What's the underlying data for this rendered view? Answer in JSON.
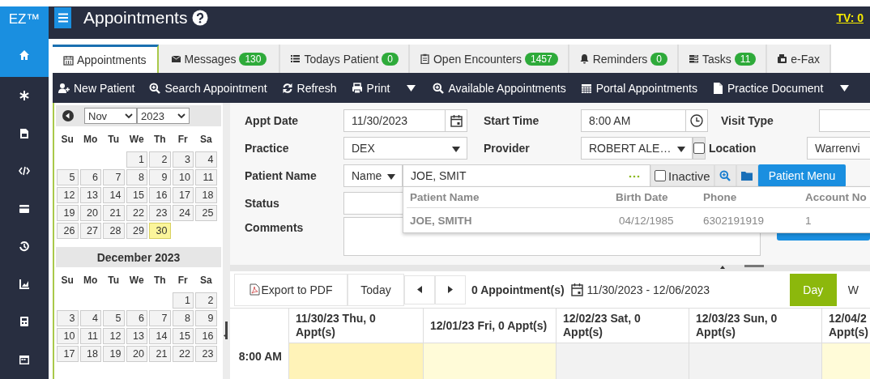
{
  "sidebar": {
    "brand": "EZ™",
    "items": [
      {
        "selected": true
      },
      {
        "selected": false
      },
      {
        "selected": false
      },
      {
        "selected": false
      },
      {
        "selected": false
      },
      {
        "selected": false
      },
      {
        "selected": false
      },
      {
        "selected": false
      },
      {
        "selected": false
      }
    ]
  },
  "header": {
    "title": "Appointments",
    "tv": "TV: 0"
  },
  "tabs": [
    {
      "label": "Appointments",
      "selected": true
    },
    {
      "label": "Messages",
      "badge": "130",
      "selected": false
    },
    {
      "label": "Todays Patient",
      "badge": "0",
      "selected": false
    },
    {
      "label": "Open Encounters",
      "badge": "1457",
      "selected": false
    },
    {
      "label": "Reminders",
      "badge": "0",
      "selected": false
    },
    {
      "label": "Tasks",
      "badge": "11",
      "selected": false
    },
    {
      "label": "e-Fax",
      "selected": false
    }
  ],
  "toolbar": [
    {
      "kind": "button",
      "label": "New Patient"
    },
    {
      "kind": "button",
      "label": "Search Appointment"
    },
    {
      "kind": "button",
      "label": "Refresh"
    },
    {
      "kind": "button",
      "label": "Print"
    },
    {
      "kind": "caret"
    },
    {
      "kind": "button",
      "label": "Available Appointments"
    },
    {
      "kind": "button",
      "label": "Portal Appointments"
    },
    {
      "kind": "button",
      "label": "Practice Document"
    },
    {
      "kind": "caret"
    }
  ],
  "calendar": {
    "month_select": "Nov",
    "year_select": "2023",
    "months": [
      {
        "weekdays": [
          "Su",
          "Mo",
          "Tu",
          "We",
          "Th",
          "Fr",
          "Sa"
        ],
        "weeks": [
          [
            {
              "kind": "blank"
            },
            {
              "kind": "blank"
            },
            {
              "kind": "blank"
            },
            {
              "kind": "day",
              "day": "1",
              "selected": false
            },
            {
              "day": "2",
              "selected": false
            },
            {
              "day": "3",
              "selected": false
            },
            {
              "day": "4",
              "selected": false
            }
          ],
          [
            {
              "day": "5",
              "selected": false
            },
            {
              "day": "6",
              "selected": false
            },
            {
              "day": "7",
              "selected": false
            },
            {
              "day": "8",
              "selected": false
            },
            {
              "day": "9",
              "selected": false
            },
            {
              "day": "10",
              "selected": false
            },
            {
              "day": "11",
              "selected": false
            }
          ],
          [
            {
              "day": "12",
              "selected": false
            },
            {
              "day": "13",
              "selected": false
            },
            {
              "day": "14",
              "selected": false
            },
            {
              "day": "15",
              "selected": false
            },
            {
              "day": "16",
              "selected": false
            },
            {
              "day": "17",
              "selected": false
            },
            {
              "day": "18",
              "selected": false
            }
          ],
          [
            {
              "day": "19",
              "selected": false
            },
            {
              "day": "20",
              "selected": false
            },
            {
              "day": "21",
              "selected": false
            },
            {
              "day": "22",
              "selected": false
            },
            {
              "day": "23",
              "selected": false
            },
            {
              "day": "24",
              "selected": false
            },
            {
              "day": "25",
              "selected": false
            }
          ],
          [
            {
              "day": "26",
              "selected": false
            },
            {
              "day": "27",
              "selected": false
            },
            {
              "day": "28",
              "selected": false
            },
            {
              "day": "29",
              "selected": false
            },
            {
              "day": "30",
              "selected": true
            },
            {
              "kind": "blank"
            },
            {
              "kind": "blank"
            }
          ]
        ]
      },
      {
        "title": "December 2023",
        "weekdays": [
          "Su",
          "Mo",
          "Tu",
          "We",
          "Th",
          "Fr",
          "Sa"
        ],
        "weeks": [
          [
            {
              "kind": "blank"
            },
            {
              "kind": "blank"
            },
            {
              "kind": "blank"
            },
            {
              "kind": "blank"
            },
            {
              "kind": "blank"
            },
            {
              "day": "1",
              "selected": false
            },
            {
              "day": "2",
              "selected": false
            }
          ],
          [
            {
              "day": "3",
              "selected": false
            },
            {
              "day": "4",
              "selected": false
            },
            {
              "day": "5",
              "selected": false
            },
            {
              "day": "6",
              "selected": false
            },
            {
              "day": "7",
              "selected": false
            },
            {
              "day": "8",
              "selected": false
            },
            {
              "day": "9",
              "selected": false
            }
          ],
          [
            {
              "day": "10",
              "selected": false
            },
            {
              "day": "11",
              "selected": false
            },
            {
              "day": "12",
              "selected": false
            },
            {
              "day": "13",
              "selected": false
            },
            {
              "day": "14",
              "selected": false
            },
            {
              "day": "15",
              "selected": false
            },
            {
              "day": "16",
              "selected": false
            }
          ],
          [
            {
              "day": "17",
              "selected": false
            },
            {
              "day": "18",
              "selected": false
            },
            {
              "day": "19",
              "selected": false
            },
            {
              "day": "20",
              "selected": false
            },
            {
              "day": "21",
              "selected": false
            },
            {
              "day": "22",
              "selected": false
            },
            {
              "day": "23",
              "selected": false
            }
          ]
        ]
      }
    ]
  },
  "form": {
    "appt_date": {
      "label": "Appt Date",
      "value": "11/30/2023"
    },
    "start_time": {
      "label": "Start Time",
      "value": "8:00 AM"
    },
    "visit_type": {
      "label": "Visit Type"
    },
    "practice": {
      "label": "Practice",
      "value": "DEX"
    },
    "provider": {
      "label": "Provider",
      "value": "ROBERT ALE…",
      "checked": false
    },
    "location": {
      "label": "Location",
      "value": "Warrenvi"
    },
    "patient_name": {
      "label": "Patient Name",
      "search_by": "Name",
      "value": "JOE, SMIT",
      "inactive": {
        "label": "Inactive",
        "checked": false
      },
      "menu_button": "Patient Menu"
    },
    "status": {
      "label": "Status"
    },
    "comments": {
      "label": "Comments"
    },
    "suggestions": {
      "columns": [
        "Patient Name",
        "Birth Date",
        "Phone",
        "Account No"
      ],
      "rows": [
        [
          "JOE, SMITH",
          "04/12/1985",
          "6302191919",
          "1"
        ]
      ]
    }
  },
  "scheduler": {
    "export": "Export to PDF",
    "today": "Today",
    "count": "0 Appointment(s)",
    "range": "11/30/2023 - 12/06/2023",
    "views": [
      {
        "label": "Day",
        "selected": true
      },
      {
        "label": "W",
        "selected": false
      }
    ],
    "columns": [
      {
        "label": "11/30/23 Thu, 0 Appt(s)",
        "kind": "today"
      },
      {
        "label": "12/01/23 Fri, 0 Appt(s)",
        "kind": "weekday"
      },
      {
        "label": "12/02/23 Sat, 0 Appt(s)",
        "kind": "weekend"
      },
      {
        "label": "12/03/23 Sun, 0 Appt(s)",
        "kind": "weekend"
      },
      {
        "label": "12/04/2 Appt(s)",
        "kind": "weekday"
      }
    ],
    "times": [
      "8:00 AM"
    ]
  }
}
